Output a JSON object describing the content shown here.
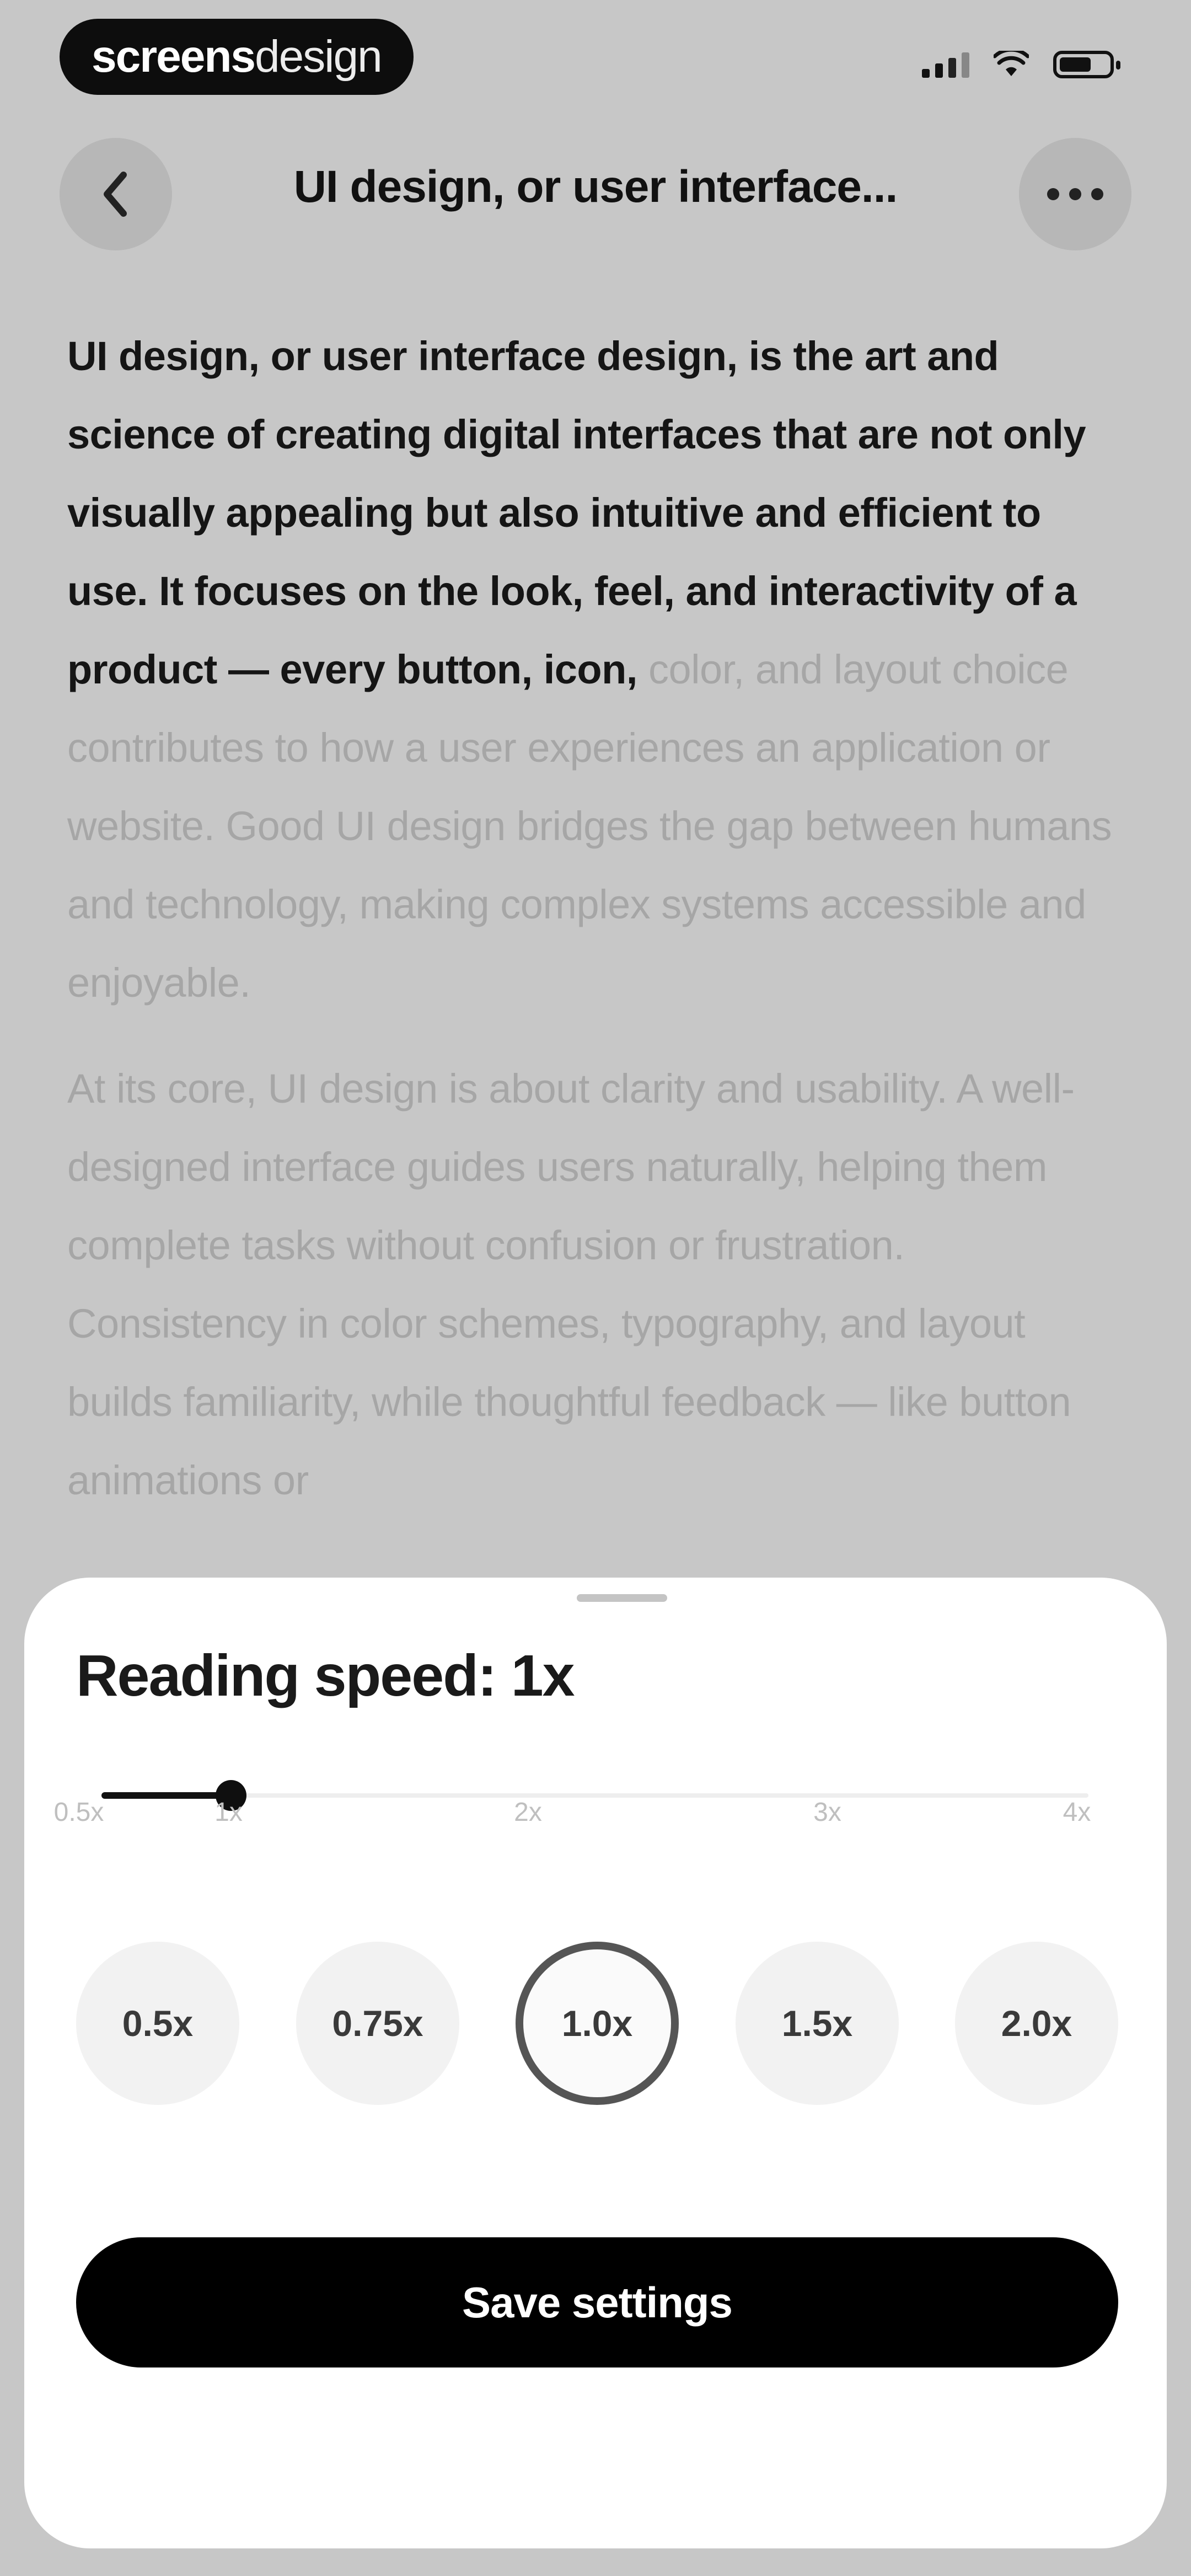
{
  "status_bar": {
    "brand_bold": "screens",
    "brand_light": "design"
  },
  "header": {
    "title": "UI design, or user interface..."
  },
  "article": {
    "p1_read": "UI design, or user interface design, is the art and science of creating digital interfaces that are not only visually appealing but also intuitive and efficient to use. It focuses on the look, feel, and interactivity of a product — every button, icon, ",
    "p1_unread": "color, and layout choice contributes to how a user experiences an application or website. Good UI design bridges the gap between humans and technology, making complex systems accessible and enjoyable.",
    "p2": "At its core, UI design is about clarity and usability. A well-designed interface guides users naturally, helping them complete tasks without confusion or frustration. Consistency in color schemes, typography, and layout builds familiarity, while thoughtful feedback — like button animations or"
  },
  "sheet": {
    "title": "Reading speed: 1x",
    "slider": {
      "min": 0.5,
      "max": 4,
      "value": 1,
      "ticks": [
        "0.5x",
        "1x",
        "2x",
        "3x",
        "4x"
      ]
    },
    "speeds": [
      {
        "label": "0.5x",
        "active": false
      },
      {
        "label": "0.75x",
        "active": false
      },
      {
        "label": "1.0x",
        "active": true
      },
      {
        "label": "1.5x",
        "active": false
      },
      {
        "label": "2.0x",
        "active": false
      }
    ],
    "save_label": "Save settings"
  },
  "colors": {
    "overlay_bg": "#c7c7c7",
    "sheet_bg": "#ffffff",
    "primary": "#000000",
    "chip_bg": "#f2f2f2"
  }
}
